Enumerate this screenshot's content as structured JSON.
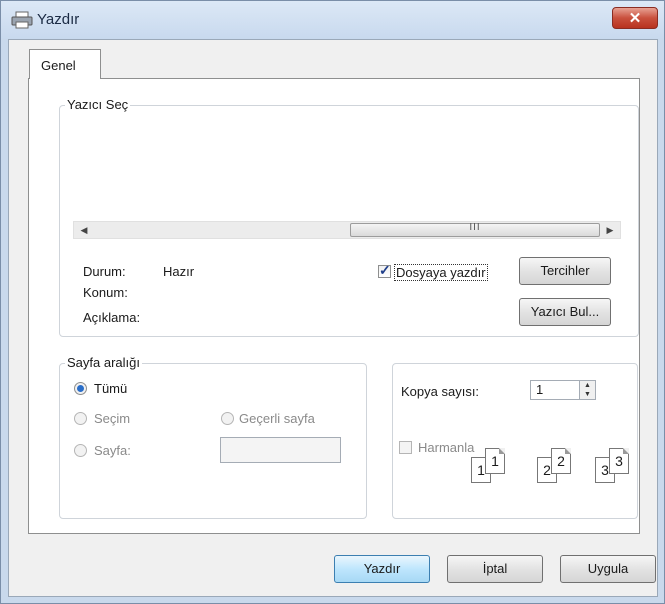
{
  "window": {
    "title": "Yazdır",
    "close_label": "✕"
  },
  "tabs": [
    {
      "label": "Genel",
      "selected": true
    }
  ],
  "printer_select": {
    "group_label": "Yazıcı Seç",
    "status_label": "Durum:",
    "status_value": "Hazır",
    "location_label": "Konum:",
    "comment_label": "Açıklama:",
    "print_to_file": {
      "label": "Dosyaya yazdır",
      "checked": true
    },
    "preferences_label": "Tercihler",
    "find_printer_label": "Yazıcı Bul...",
    "scroll_grip": "III"
  },
  "page_range": {
    "group_label": "Sayfa aralığı",
    "all_label": "Tümü",
    "selection_label": "Seçim",
    "current_page_label": "Geçerli sayfa",
    "pages_label": "Sayfa:",
    "pages_value": ""
  },
  "copies": {
    "label": "Kopya sayısı:",
    "value": "1",
    "collate_label": "Harmanla",
    "collate_checked": false,
    "collate_pages": [
      "1",
      "1",
      "2",
      "2",
      "3",
      "3"
    ]
  },
  "buttons": {
    "print": "Yazdır",
    "cancel": "İptal",
    "apply": "Uygula"
  },
  "colors": {
    "accent": "#3c7fb1",
    "close": "#c9503d"
  }
}
